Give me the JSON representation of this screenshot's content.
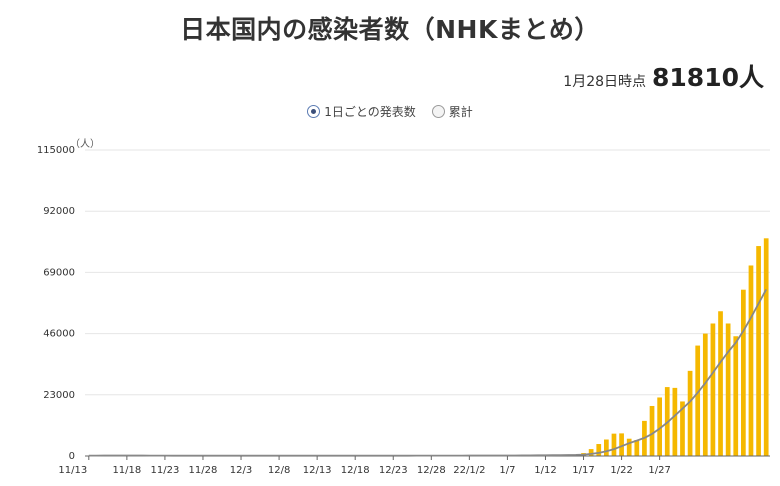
{
  "page": {
    "title": "日本国内の感染者数（NHKまとめ）",
    "as_of_label": "1月28日時点",
    "as_of_value": "81810人"
  },
  "toggle": {
    "options": [
      {
        "label": "1日ごとの発表数",
        "selected": true
      },
      {
        "label": "累計",
        "selected": false
      }
    ]
  },
  "colors": {
    "bar": "#f5b800",
    "avg_line": "#888888",
    "grid": "#e6e6e6",
    "axis": "#666666"
  },
  "chart_data": {
    "type": "bar",
    "y_unit": "（人）",
    "ylim": [
      0,
      115000
    ],
    "yticks": [
      "0",
      "23000",
      "46000",
      "69000",
      "92000",
      "115000"
    ],
    "x_start_label": "11/13",
    "x_tick_labels": [
      "11/13",
      "11/18",
      "11/23",
      "11/28",
      "12/3",
      "12/8",
      "12/13",
      "12/18",
      "12/23",
      "12/28",
      "22/1/2",
      "1/7",
      "1/12",
      "1/17",
      "1/22",
      "1/27"
    ],
    "grid": true,
    "series": [
      {
        "type": "bar",
        "values": [
          150,
          200,
          160,
          170,
          230,
          200,
          180,
          140,
          150,
          100,
          80,
          120,
          160,
          140,
          120,
          80,
          130,
          100,
          110,
          110,
          120,
          90,
          60,
          100,
          100,
          120,
          110,
          120,
          130,
          120,
          90,
          100,
          140,
          150,
          120,
          130,
          110,
          120,
          120,
          120,
          130,
          140,
          140,
          150,
          170,
          120,
          150,
          150,
          170,
          180,
          190,
          200,
          190,
          160,
          170,
          200,
          220,
          250,
          300,
          300,
          320,
          380,
          400,
          450,
          550,
          1100,
          2600,
          4500,
          6200,
          8400,
          8500,
          6500,
          6000,
          13200,
          18800,
          22000,
          25900,
          25600,
          20500,
          32000,
          41500,
          46000,
          49800,
          54400,
          49800,
          45000,
          62500,
          71600,
          78900,
          81810
        ]
      },
      {
        "type": "line",
        "values": [
          160,
          160,
          170,
          180,
          180,
          180,
          180,
          170,
          160,
          150,
          140,
          130,
          130,
          130,
          120,
          110,
          110,
          110,
          120,
          120,
          110,
          110,
          100,
          100,
          100,
          100,
          100,
          110,
          110,
          110,
          110,
          110,
          120,
          120,
          120,
          120,
          120,
          120,
          120,
          120,
          130,
          130,
          130,
          140,
          140,
          140,
          150,
          150,
          150,
          160,
          170,
          170,
          180,
          180,
          180,
          190,
          200,
          220,
          240,
          260,
          280,
          300,
          330,
          360,
          410,
          520,
          790,
          1170,
          1750,
          2600,
          3700,
          4800,
          5800,
          6800,
          8300,
          10300,
          12600,
          15200,
          17800,
          20500,
          23800,
          27400,
          31300,
          35300,
          39100,
          42600,
          47000,
          52000,
          57300,
          62600
        ]
      }
    ]
  }
}
